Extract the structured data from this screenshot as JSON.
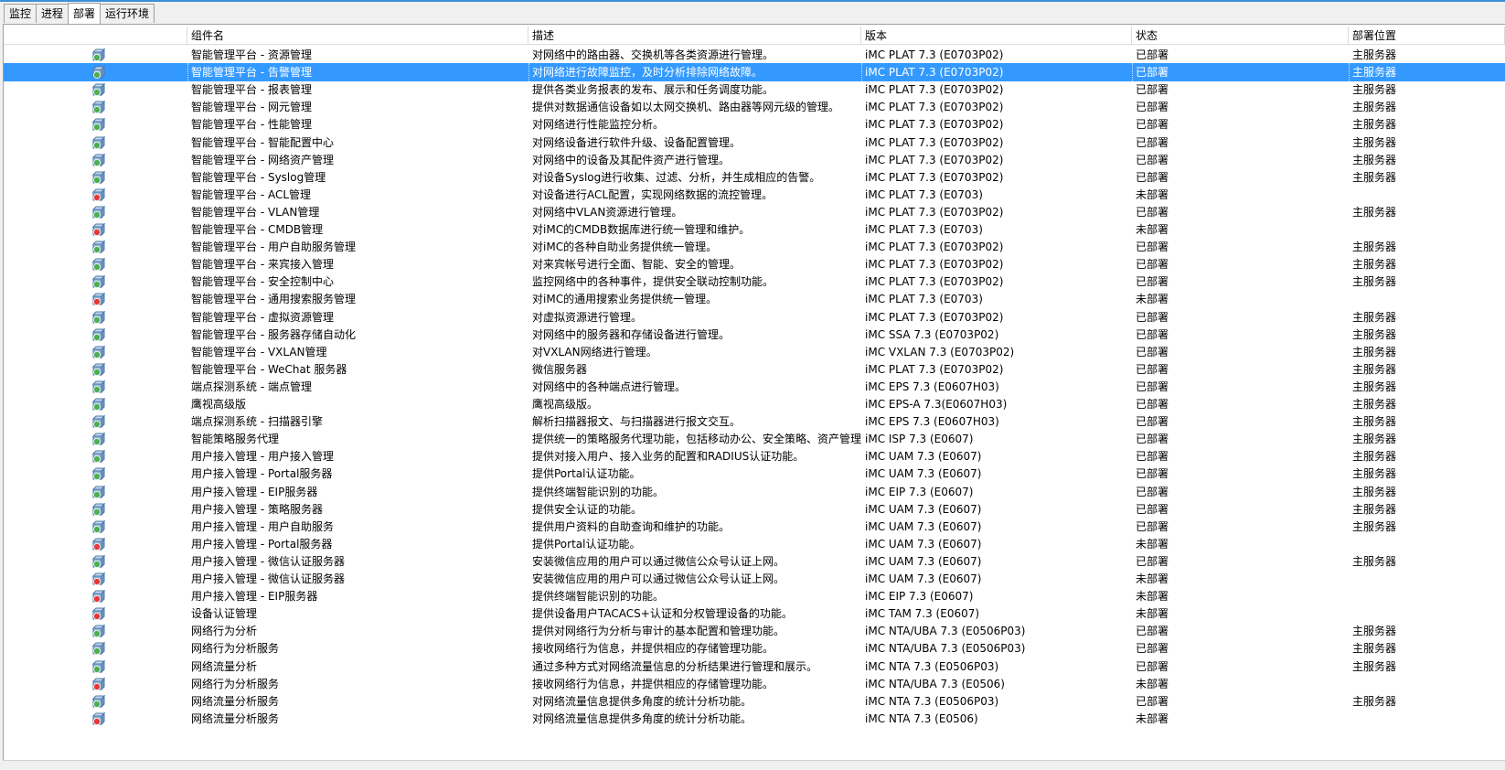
{
  "tabs": [
    {
      "label": "监控",
      "active": false
    },
    {
      "label": "进程",
      "active": false
    },
    {
      "label": "部署",
      "active": true
    },
    {
      "label": "运行环境",
      "active": false
    }
  ],
  "columns": {
    "name": "组件名",
    "desc": "描述",
    "version": "版本",
    "status": "状态",
    "location": "部署位置"
  },
  "rows": [
    {
      "icon": "component-deployed-icon",
      "name": "智能管理平台 - 资源管理",
      "desc": "对网络中的路由器、交换机等各类资源进行管理。",
      "version": "iMC PLAT 7.3 (E0703P02)",
      "status": "已部署",
      "location": "主服务器"
    },
    {
      "icon": "component-deployed-icon",
      "name": "智能管理平台 - 告警管理",
      "desc": "对网络进行故障监控，及时分析排除网络故障。",
      "version": "iMC PLAT 7.3 (E0703P02)",
      "status": "已部署",
      "location": "主服务器",
      "selected": true
    },
    {
      "icon": "component-deployed-icon",
      "name": "智能管理平台 - 报表管理",
      "desc": "提供各类业务报表的发布、展示和任务调度功能。",
      "version": "iMC PLAT 7.3 (E0703P02)",
      "status": "已部署",
      "location": "主服务器"
    },
    {
      "icon": "component-deployed-icon",
      "name": "智能管理平台 - 网元管理",
      "desc": "提供对数据通信设备如以太网交换机、路由器等网元级的管理。",
      "version": "iMC PLAT 7.3 (E0703P02)",
      "status": "已部署",
      "location": "主服务器"
    },
    {
      "icon": "component-deployed-icon",
      "name": "智能管理平台 - 性能管理",
      "desc": "对网络进行性能监控分析。",
      "version": "iMC PLAT 7.3 (E0703P02)",
      "status": "已部署",
      "location": "主服务器"
    },
    {
      "icon": "component-deployed-icon",
      "name": "智能管理平台 - 智能配置中心",
      "desc": "对网络设备进行软件升级、设备配置管理。",
      "version": "iMC PLAT 7.3 (E0703P02)",
      "status": "已部署",
      "location": "主服务器"
    },
    {
      "icon": "component-deployed-icon",
      "name": "智能管理平台 - 网络资产管理",
      "desc": "对网络中的设备及其配件资产进行管理。",
      "version": "iMC PLAT 7.3 (E0703P02)",
      "status": "已部署",
      "location": "主服务器"
    },
    {
      "icon": "component-deployed-icon",
      "name": "智能管理平台 - Syslog管理",
      "desc": "对设备Syslog进行收集、过滤、分析，并生成相应的告警。",
      "version": "iMC PLAT 7.3 (E0703P02)",
      "status": "已部署",
      "location": "主服务器"
    },
    {
      "icon": "component-undeployed-icon",
      "name": "智能管理平台 - ACL管理",
      "desc": "对设备进行ACL配置，实现网络数据的流控管理。",
      "version": "iMC PLAT 7.3 (E0703)",
      "status": "未部署",
      "location": ""
    },
    {
      "icon": "component-deployed-icon",
      "name": "智能管理平台 - VLAN管理",
      "desc": "对网络中VLAN资源进行管理。",
      "version": "iMC PLAT 7.3 (E0703P02)",
      "status": "已部署",
      "location": "主服务器"
    },
    {
      "icon": "component-undeployed-icon",
      "name": "智能管理平台 - CMDB管理",
      "desc": "对iMC的CMDB数据库进行统一管理和维护。",
      "version": "iMC PLAT 7.3 (E0703)",
      "status": "未部署",
      "location": ""
    },
    {
      "icon": "component-deployed-icon",
      "name": "智能管理平台 - 用户自助服务管理",
      "desc": "对iMC的各种自助业务提供统一管理。",
      "version": "iMC PLAT 7.3 (E0703P02)",
      "status": "已部署",
      "location": "主服务器"
    },
    {
      "icon": "component-deployed-icon",
      "name": "智能管理平台 - 来宾接入管理",
      "desc": "对来宾帐号进行全面、智能、安全的管理。",
      "version": "iMC PLAT 7.3 (E0703P02)",
      "status": "已部署",
      "location": "主服务器"
    },
    {
      "icon": "component-deployed-icon",
      "name": "智能管理平台 - 安全控制中心",
      "desc": "监控网络中的各种事件，提供安全联动控制功能。",
      "version": "iMC PLAT 7.3 (E0703P02)",
      "status": "已部署",
      "location": "主服务器"
    },
    {
      "icon": "component-undeployed-icon",
      "name": "智能管理平台 - 通用搜索服务管理",
      "desc": "对iMC的通用搜索业务提供统一管理。",
      "version": "iMC PLAT 7.3 (E0703)",
      "status": "未部署",
      "location": ""
    },
    {
      "icon": "component-deployed-icon",
      "name": "智能管理平台 - 虚拟资源管理",
      "desc": "对虚拟资源进行管理。",
      "version": "iMC PLAT 7.3 (E0703P02)",
      "status": "已部署",
      "location": "主服务器"
    },
    {
      "icon": "component-deployed-icon",
      "name": "智能管理平台 - 服务器存储自动化",
      "desc": "对网络中的服务器和存储设备进行管理。",
      "version": "iMC SSA 7.3 (E0703P02)",
      "status": "已部署",
      "location": "主服务器"
    },
    {
      "icon": "component-deployed-icon",
      "name": "智能管理平台 - VXLAN管理",
      "desc": "对VXLAN网络进行管理。",
      "version": "iMC VXLAN 7.3 (E0703P02)",
      "status": "已部署",
      "location": "主服务器"
    },
    {
      "icon": "component-deployed-icon",
      "name": "智能管理平台 - WeChat 服务器",
      "desc": "微信服务器",
      "version": "iMC PLAT 7.3 (E0703P02)",
      "status": "已部署",
      "location": "主服务器"
    },
    {
      "icon": "component-deployed-icon",
      "name": "端点探测系统 - 端点管理",
      "desc": "对网络中的各种端点进行管理。",
      "version": "iMC EPS 7.3 (E0607H03)",
      "status": "已部署",
      "location": "主服务器"
    },
    {
      "icon": "component-deployed-icon",
      "name": "鹰视高级版",
      "desc": "鹰视高级版。",
      "version": "iMC EPS-A 7.3(E0607H03)",
      "status": "已部署",
      "location": "主服务器"
    },
    {
      "icon": "component-deployed-icon",
      "name": "端点探测系统 - 扫描器引擎",
      "desc": "解析扫描器报文、与扫描器进行报文交互。",
      "version": "iMC EPS 7.3 (E0607H03)",
      "status": "已部署",
      "location": "主服务器"
    },
    {
      "icon": "component-deployed-icon",
      "name": "智能策略服务代理",
      "desc": "提供统一的策略服务代理功能，包括移动办公、安全策略、资产管理...",
      "version": "iMC ISP 7.3 (E0607)",
      "status": "已部署",
      "location": "主服务器"
    },
    {
      "icon": "component-deployed-icon",
      "name": "用户接入管理 - 用户接入管理",
      "desc": "提供对接入用户、接入业务的配置和RADIUS认证功能。",
      "version": "iMC UAM 7.3 (E0607)",
      "status": "已部署",
      "location": "主服务器"
    },
    {
      "icon": "component-deployed-icon",
      "name": "用户接入管理 - Portal服务器",
      "desc": "提供Portal认证功能。",
      "version": "iMC UAM 7.3 (E0607)",
      "status": "已部署",
      "location": "主服务器"
    },
    {
      "icon": "component-deployed-icon",
      "name": "用户接入管理 - EIP服务器",
      "desc": "提供终端智能识别的功能。",
      "version": "iMC EIP 7.3 (E0607)",
      "status": "已部署",
      "location": "主服务器"
    },
    {
      "icon": "component-deployed-icon",
      "name": "用户接入管理 - 策略服务器",
      "desc": "提供安全认证的功能。",
      "version": "iMC UAM 7.3 (E0607)",
      "status": "已部署",
      "location": "主服务器"
    },
    {
      "icon": "component-deployed-icon",
      "name": "用户接入管理 - 用户自助服务",
      "desc": "提供用户资料的自助查询和维护的功能。",
      "version": "iMC UAM 7.3 (E0607)",
      "status": "已部署",
      "location": "主服务器"
    },
    {
      "icon": "component-undeployed-icon",
      "name": "用户接入管理 - Portal服务器",
      "desc": "提供Portal认证功能。",
      "version": "iMC UAM 7.3 (E0607)",
      "status": "未部署",
      "location": ""
    },
    {
      "icon": "component-deployed-icon",
      "name": "用户接入管理 - 微信认证服务器",
      "desc": "安装微信应用的用户可以通过微信公众号认证上网。",
      "version": "iMC UAM 7.3 (E0607)",
      "status": "已部署",
      "location": "主服务器"
    },
    {
      "icon": "component-undeployed-icon",
      "name": "用户接入管理 - 微信认证服务器",
      "desc": "安装微信应用的用户可以通过微信公众号认证上网。",
      "version": "iMC UAM 7.3 (E0607)",
      "status": "未部署",
      "location": ""
    },
    {
      "icon": "component-undeployed-icon",
      "name": "用户接入管理 - EIP服务器",
      "desc": "提供终端智能识别的功能。",
      "version": "iMC EIP 7.3 (E0607)",
      "status": "未部署",
      "location": ""
    },
    {
      "icon": "component-undeployed-icon",
      "name": "设备认证管理",
      "desc": "提供设备用户TACACS+认证和分权管理设备的功能。",
      "version": "iMC TAM 7.3 (E0607)",
      "status": "未部署",
      "location": ""
    },
    {
      "icon": "component-deployed-icon",
      "name": "网络行为分析",
      "desc": "提供对网络行为分析与审计的基本配置和管理功能。",
      "version": "iMC NTA/UBA 7.3 (E0506P03)",
      "status": "已部署",
      "location": "主服务器"
    },
    {
      "icon": "component-deployed-icon",
      "name": "网络行为分析服务",
      "desc": "接收网络行为信息，并提供相应的存储管理功能。",
      "version": "iMC NTA/UBA 7.3 (E0506P03)",
      "status": "已部署",
      "location": "主服务器"
    },
    {
      "icon": "component-deployed-icon",
      "name": "网络流量分析",
      "desc": "通过多种方式对网络流量信息的分析结果进行管理和展示。",
      "version": "iMC NTA 7.3 (E0506P03)",
      "status": "已部署",
      "location": "主服务器"
    },
    {
      "icon": "component-undeployed-icon",
      "name": "网络行为分析服务",
      "desc": "接收网络行为信息，并提供相应的存储管理功能。",
      "version": "iMC NTA/UBA 7.3 (E0506)",
      "status": "未部署",
      "location": ""
    },
    {
      "icon": "component-deployed-icon",
      "name": "网络流量分析服务",
      "desc": "对网络流量信息提供多角度的统计分析功能。",
      "version": "iMC NTA 7.3 (E0506P03)",
      "status": "已部署",
      "location": "主服务器"
    },
    {
      "icon": "component-undeployed-icon",
      "name": "网络流量分析服务",
      "desc": "对网络流量信息提供多角度的统计分析功能。",
      "version": "iMC NTA 7.3 (E0506)",
      "status": "未部署",
      "location": ""
    }
  ],
  "colors": {
    "selection": "#3399ff",
    "deployed_icon": "#4caf50",
    "undeployed_icon": "#e53935",
    "tab_bar_accent": "#3c8fd8"
  }
}
